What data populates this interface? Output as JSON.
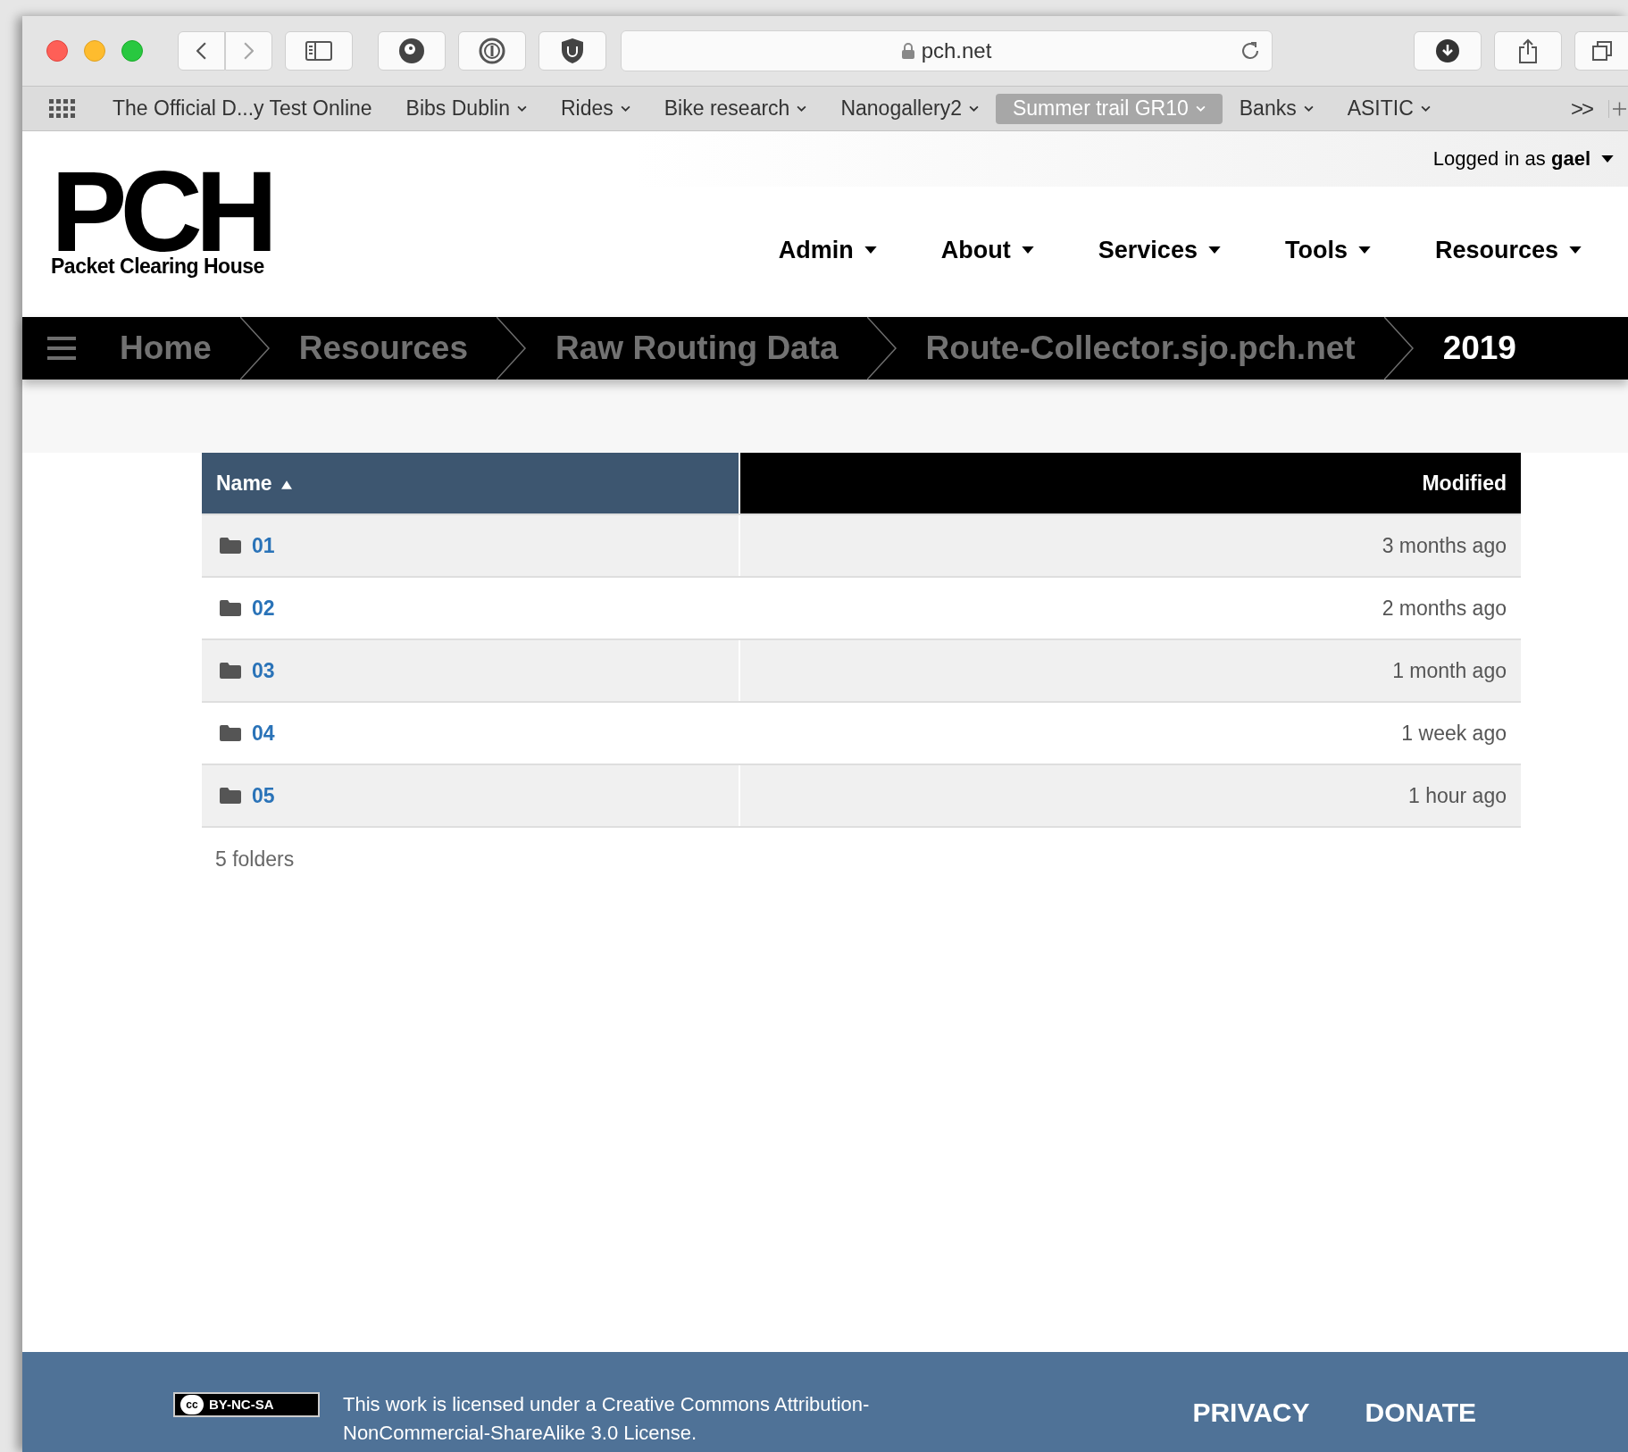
{
  "browser": {
    "address": "pch.net",
    "overflow": ">>",
    "bookmarks": [
      {
        "label": "The Official D...y Test Online",
        "has_menu": false,
        "selected": false
      },
      {
        "label": "Bibs Dublin",
        "has_menu": true,
        "selected": false
      },
      {
        "label": "Rides",
        "has_menu": true,
        "selected": false
      },
      {
        "label": "Bike research",
        "has_menu": true,
        "selected": false
      },
      {
        "label": "Nanogallery2",
        "has_menu": true,
        "selected": false
      },
      {
        "label": "Summer trail GR10",
        "has_menu": true,
        "selected": true
      },
      {
        "label": "Banks",
        "has_menu": true,
        "selected": false
      },
      {
        "label": "ASITIC",
        "has_menu": true,
        "selected": false
      }
    ]
  },
  "header": {
    "user": "Logged in as **gael**",
    "logo": {
      "mark": "PCH",
      "name": "Packet Clearing House"
    },
    "nav": [
      "Admin",
      "About",
      "Services",
      "Tools",
      "Resources"
    ]
  },
  "breadcrumb": [
    {
      "label": "Home",
      "selected": false
    },
    {
      "label": "Resources",
      "selected": false
    },
    {
      "label": "Raw Routing Data",
      "selected": false
    },
    {
      "label": "Route-Collector.sjo.pch.net",
      "selected": false
    },
    {
      "label": "2019",
      "selected": true
    }
  ],
  "table": {
    "columns": [
      {
        "label": "Name",
        "sorted": true
      },
      {
        "label": "Modified",
        "sorted": false
      }
    ],
    "rows": [
      {
        "name": "01",
        "modified": "3 months ago"
      },
      {
        "name": "02",
        "modified": "2 months ago"
      },
      {
        "name": "03",
        "modified": "1 month ago"
      },
      {
        "name": "04",
        "modified": "1 week ago"
      },
      {
        "name": "05",
        "modified": "1 hour ago"
      }
    ],
    "summary": "5 folders"
  },
  "footer": {
    "badge": "BY-NC-SA",
    "badge_icon": "cc",
    "license": "This work is licensed under a Creative Commons Attribution-NonCommercial-ShareAlike 3.0 License.",
    "links": [
      "PRIVACY",
      "DONATE"
    ]
  }
}
